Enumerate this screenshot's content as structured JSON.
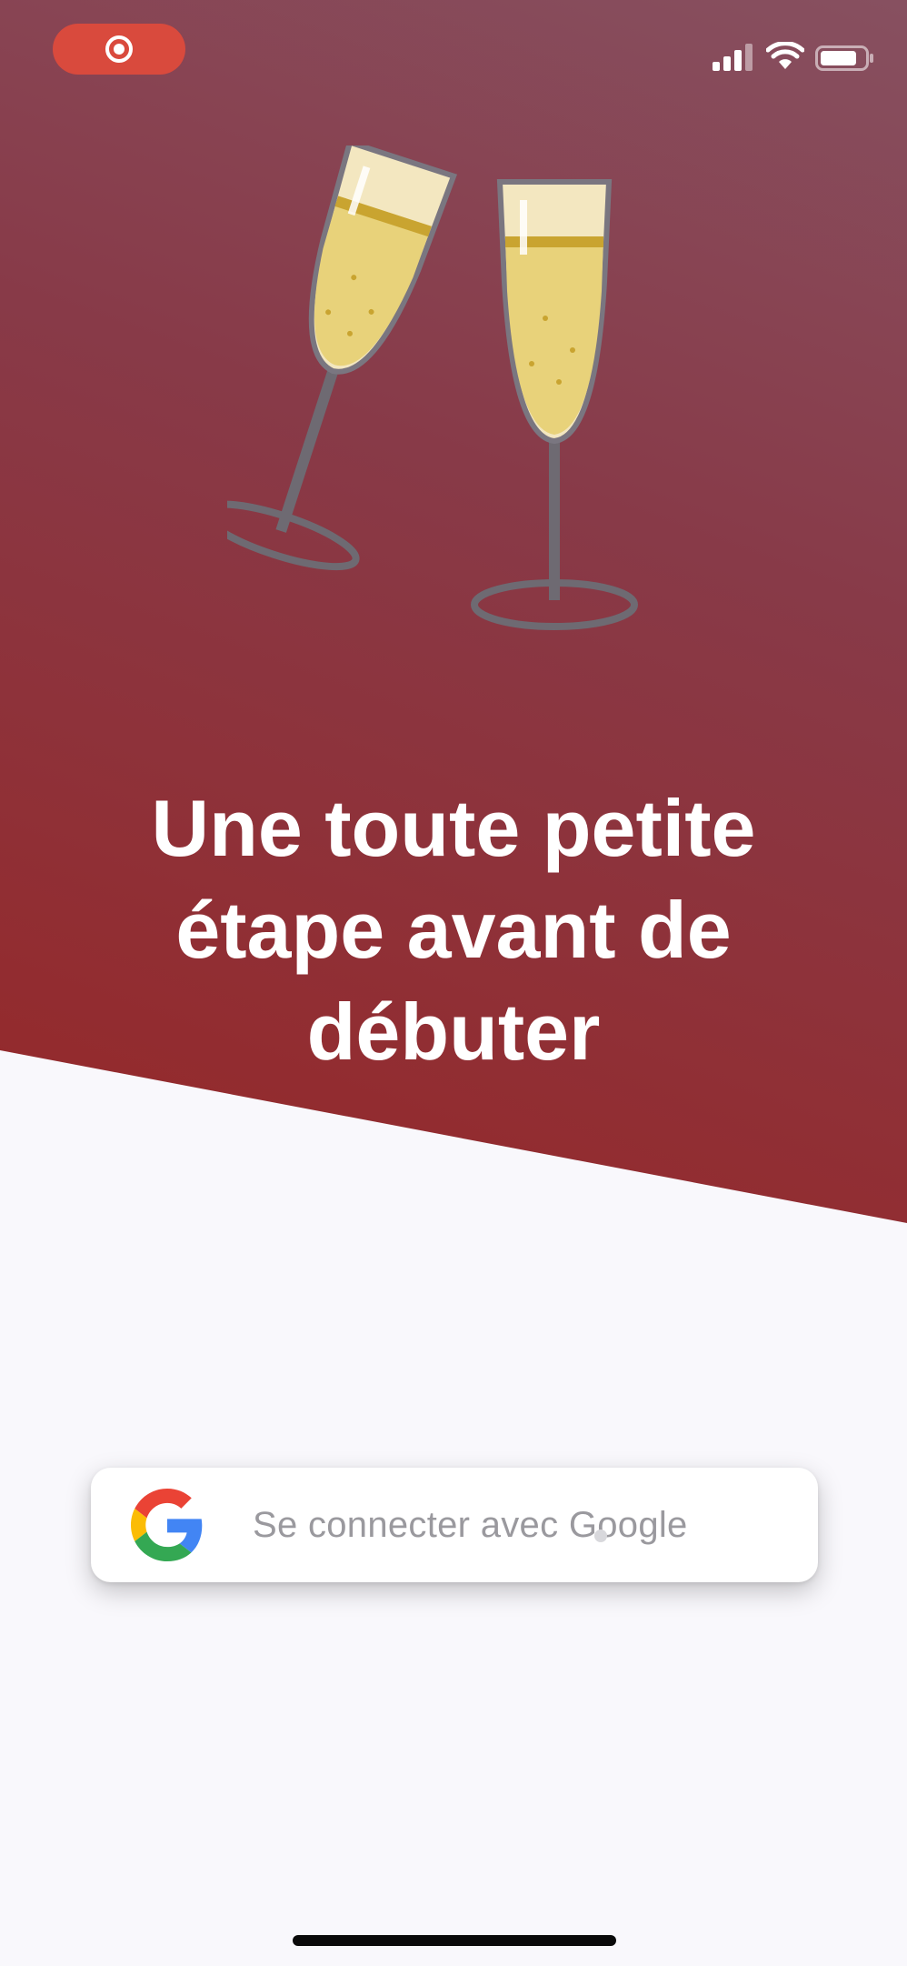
{
  "hero": {
    "title": "Une toute petite étape avant de débuter",
    "illustration": "champagne-glasses-toast"
  },
  "status_bar": {
    "recording_indicator": "screen-recording-icon",
    "icons": [
      "cellular-signal-icon",
      "wifi-icon",
      "battery-icon"
    ]
  },
  "auth": {
    "google_button_label": "Se connecter avec Google",
    "google_icon": "google-g-icon"
  },
  "colors": {
    "hero_top": "#875060",
    "hero_bottom": "#962727",
    "background": "#f9f8fc",
    "button_text": "#9a999e",
    "record_pill": "#d94a3d"
  }
}
